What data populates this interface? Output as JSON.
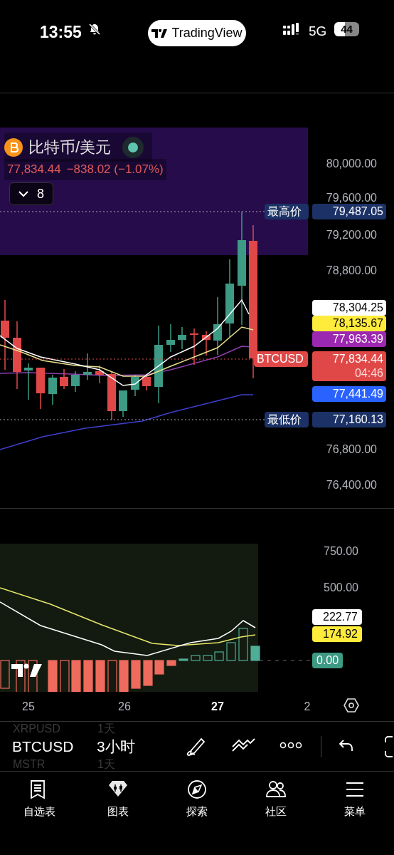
{
  "status_bar": {
    "time": "13:55",
    "app": "TradingView",
    "network": "5G",
    "battery": "44"
  },
  "chart": {
    "symbol_title": "比特币/美元",
    "live": true,
    "price": "77,834.44",
    "change": "−838.02 (−1.07%)",
    "indicators_button": "8",
    "price_axis": [
      "80,000.00",
      "79,600.00",
      "79,200.00",
      "78,800.00",
      "76,800.00",
      "76,400.00"
    ],
    "price_tags": [
      {
        "kind": "extreme",
        "label": "最高价",
        "value": "79,487.05",
        "color": "#1c3266"
      },
      {
        "kind": "line",
        "value": "78,304.25",
        "color": "#ffffff"
      },
      {
        "kind": "line",
        "value": "78,135.67",
        "color": "#ffeb3b"
      },
      {
        "kind": "line",
        "value": "77,963.39",
        "color": "#9c27b0"
      },
      {
        "kind": "last",
        "label": "BTCUSD",
        "value": "77,834.44",
        "countdown": "04:46",
        "color": "#e04848"
      },
      {
        "kind": "line",
        "value": "77,441.49",
        "color": "#2962ff"
      },
      {
        "kind": "extreme",
        "label": "最低价",
        "value": "77,160.13",
        "color": "#1c3266"
      }
    ]
  },
  "indicator": {
    "axis": [
      "750.00",
      "500.00"
    ],
    "tags": [
      {
        "value": "222.77",
        "color": "#ffffff"
      },
      {
        "value": "174.92",
        "color": "#ffeb3b"
      },
      {
        "value": "0.00",
        "color": "#3d9a84"
      }
    ]
  },
  "time_axis": [
    {
      "label": "25",
      "current": false
    },
    {
      "label": "26",
      "current": false
    },
    {
      "label": "27",
      "current": true
    },
    {
      "label": "2",
      "current": false
    }
  ],
  "toolbar": {
    "symbol": "BTCUSD",
    "interval": "3小时",
    "picker_above": {
      "symbol": "XRPUSD",
      "interval": "1天"
    },
    "picker_below": {
      "symbol": "MSTR",
      "interval": "1天"
    }
  },
  "nav": [
    {
      "label": "自选表"
    },
    {
      "label": "图表"
    },
    {
      "label": "探索"
    },
    {
      "label": "社区"
    },
    {
      "label": "菜单"
    }
  ]
}
